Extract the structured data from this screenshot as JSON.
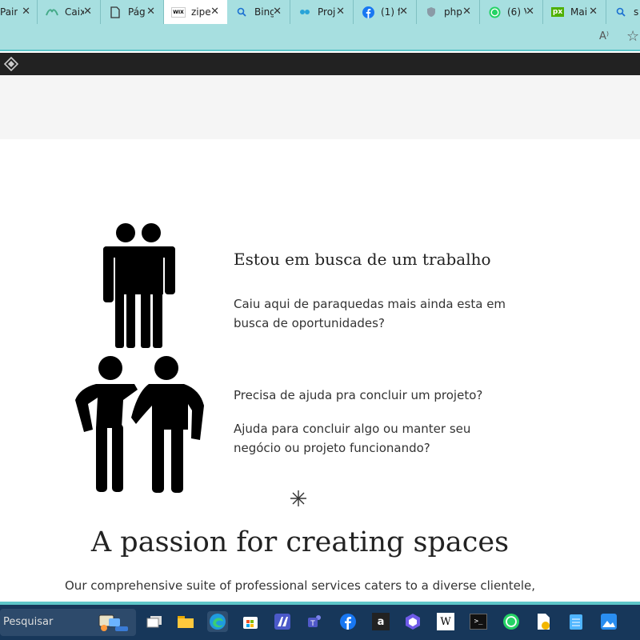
{
  "browser": {
    "tabs": [
      {
        "title": "Pain",
        "icon": "page-icon"
      },
      {
        "title": "Caix",
        "icon": "plant-icon"
      },
      {
        "title": "Pág",
        "icon": "document-icon"
      },
      {
        "title": "zipe",
        "icon": "wix-icon",
        "active": true
      },
      {
        "title": "Bing",
        "icon": "search-icon"
      },
      {
        "title": "Proj",
        "icon": "link-icon"
      },
      {
        "title": "(1) f",
        "icon": "facebook-icon"
      },
      {
        "title": "php",
        "icon": "shield-icon"
      },
      {
        "title": "(6) V",
        "icon": "whatsapp-icon"
      },
      {
        "title": "Mai",
        "icon": "px-icon"
      },
      {
        "title": "sil",
        "icon": "search-icon"
      }
    ],
    "wix_tab_badge": "WIX",
    "px_badge": "px",
    "read_aloud_label": "A⁾",
    "favorite_icon": "star-outline-icon"
  },
  "page": {
    "heading1": "Estou em busca de um trabalho",
    "para1": "Caiu aqui de paraquedas mais ainda esta em busca de oportunidades?",
    "heading2": "Precisa de ajuda pra concluir um projeto?",
    "para2": "Ajuda para concluir algo ou manter seu negócio ou projeto funcionando?",
    "title": "A passion for creating spaces",
    "subtitle": "Our comprehensive suite of professional services caters to a diverse clientele,"
  },
  "taskbar": {
    "search_placeholder": "Pesquisar",
    "apps": [
      "task-view-icon",
      "file-explorer-icon",
      "edge-icon",
      "store-icon",
      "app-icon",
      "teams-icon",
      "facebook-icon",
      "amazon-icon",
      "app2-icon",
      "wikipedia-icon",
      "terminal-icon",
      "whatsapp-icon",
      "pdf-icon",
      "notepad-icon",
      "photos-icon"
    ],
    "amazon_letter": "a",
    "wiki_letter": "W",
    "terminal_glyph": ">_"
  },
  "colors": {
    "tab_strip": "#a7dfe0",
    "accent": "#5dc5c8",
    "wix_bar": "#222222",
    "taskbar": "#17375a"
  }
}
